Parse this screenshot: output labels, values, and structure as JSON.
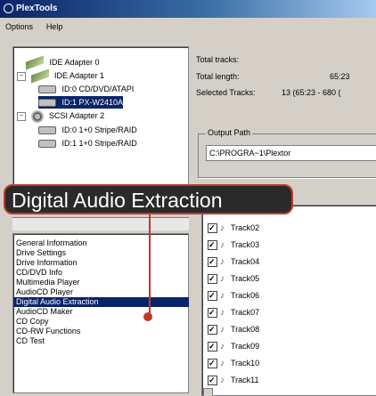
{
  "window": {
    "title": "PlexTools"
  },
  "menu": [
    "Options",
    "Help"
  ],
  "tree": {
    "items": [
      {
        "label": "IDE Adapter 0",
        "type": "adapter"
      },
      {
        "label": "IDE Adapter 1",
        "type": "adapter"
      },
      {
        "label": "ID:0  CD/DVD/ATAPI",
        "type": "drive"
      },
      {
        "label": "ID:1  PX-W2410A",
        "type": "drive",
        "selected": true
      },
      {
        "label": "SCSI Adapter 2",
        "type": "scsi"
      },
      {
        "label": "ID:0  1+0 Stripe/RAID",
        "type": "drive"
      },
      {
        "label": "ID:1  1+0 Stripe/RAID",
        "type": "drive"
      }
    ]
  },
  "info": {
    "total_tracks_label": "Total tracks:",
    "total_length_label": "Total length:",
    "total_length_value": "65:23",
    "selected_tracks_label": "Selected Tracks:",
    "selected_tracks_value": "13  (65:23 - 680 ("
  },
  "output": {
    "group_title": "Output Path",
    "path": "C:\\PROGRA~1\\Plextor"
  },
  "callout": {
    "text": "Digital Audio Extraction"
  },
  "functions": {
    "items": [
      "General Information",
      "Drive Settings",
      "Drive Information",
      "CD/DVD Info",
      "Multimedia Player",
      "AudioCD Player",
      "Digital Audio Extraction",
      "AudioCD Maker",
      "CD Copy",
      "CD-RW Functions",
      "CD Test"
    ],
    "selected": "Digital Audio Extraction"
  },
  "tracks": [
    "Track02",
    "Track03",
    "Track04",
    "Track05",
    "Track06",
    "Track07",
    "Track08",
    "Track09",
    "Track10",
    "Track11"
  ],
  "colors": {
    "accent": "#c0392b",
    "selection": "#0a246a",
    "title_start": "#0a246a",
    "title_end": "#a6caf0"
  }
}
